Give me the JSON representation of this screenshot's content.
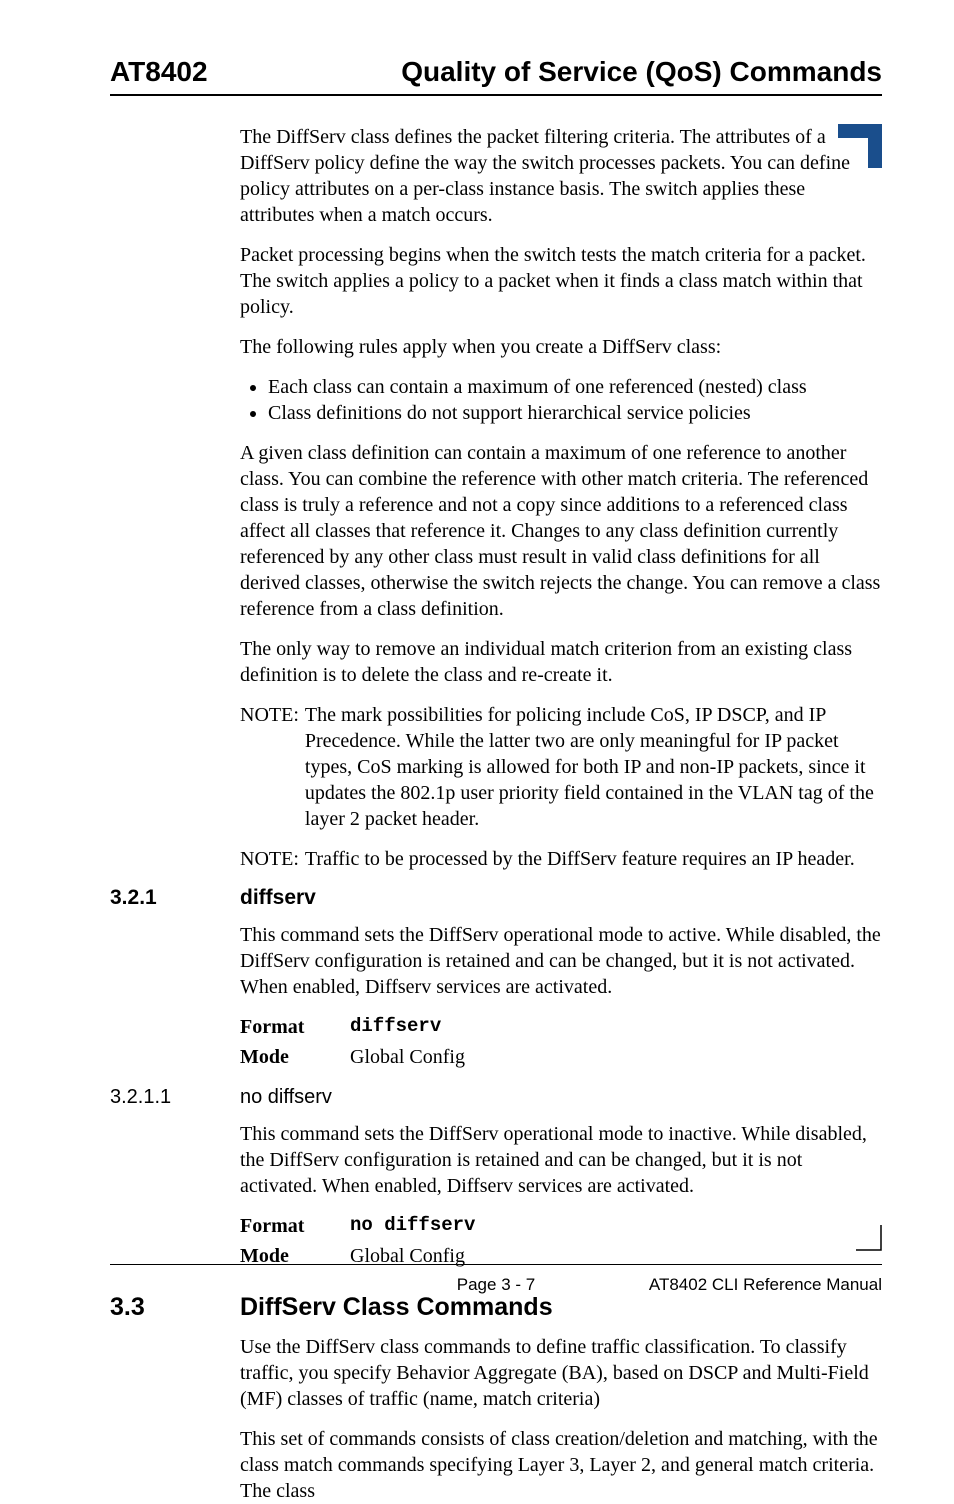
{
  "header": {
    "left": "AT8402",
    "right": "Quality of Service (QoS) Commands"
  },
  "body": {
    "p1": "The DiffServ class defines the packet filtering criteria. The attributes of a DiffServ policy define the way the switch processes packets. You can define policy attributes on a per-class instance basis. The switch applies these attributes when a match occurs.",
    "p2": "Packet processing begins when the switch tests the match criteria for a packet. The switch applies a policy to a packet when it finds a class match within that policy.",
    "p3": "The following rules apply when you create a DiffServ class:",
    "bullets": [
      "Each class can contain a maximum of one referenced (nested) class",
      "Class definitions do not support hierarchical service policies"
    ],
    "p4": "A given class definition can contain a maximum of one reference to another class. You can combine the reference with other match criteria. The referenced class is truly a reference and not a copy since additions to a referenced class affect all classes that reference it. Changes to any class definition currently referenced by any other class must result in valid class definitions for all derived classes, otherwise the switch rejects the change. You can remove a class reference from a class definition.",
    "p5": "The only way to remove an individual match criterion from an existing class definition is to delete the class and re-create it.",
    "note1_label": "NOTE:",
    "note1_body": "The mark possibilities for policing include CoS, IP DSCP, and IP Precedence. While the latter two are only meaningful for IP packet types, CoS marking is allowed for both IP and non-IP packets, since it updates the 802.1p user priority field contained in the VLAN tag of the layer 2 packet header.",
    "note2_label": "NOTE:",
    "note2_body": "Traffic to be processed by the DiffServ feature requires an IP header."
  },
  "s321": {
    "num": "3.2.1",
    "title": "diffserv",
    "p": "This command sets the DiffServ operational mode to active. While disabled, the DiffServ configuration is retained and can be changed, but it is not activated. When enabled, Diffserv services are activated.",
    "format_k": "Format",
    "format_v": "diffserv",
    "mode_k": "Mode",
    "mode_v": "Global Config"
  },
  "s3211": {
    "num": "3.2.1.1",
    "title": "no diffserv",
    "p": "This command sets the DiffServ operational mode to inactive. While disabled, the DiffServ configuration is retained and can be changed, but it is not activated. When enabled, Diffserv services are activated.",
    "format_k": "Format",
    "format_v": "no diffserv",
    "mode_k": "Mode",
    "mode_v": "Global Config"
  },
  "s33": {
    "num": "3.3",
    "title": "DiffServ Class Commands",
    "p1": "Use the DiffServ class commands to define traffic classification. To classify traffic, you specify Behavior Aggregate (BA), based on DSCP and Multi-Field (MF) classes of traffic (name, match criteria)",
    "p2": "This set of commands consists of class creation/deletion and matching, with the class match commands specifying Layer 3, Layer 2, and general match criteria. The class"
  },
  "footer": {
    "left": "",
    "center": "Page 3 - 7",
    "right": "AT8402 CLI Reference Manual"
  }
}
